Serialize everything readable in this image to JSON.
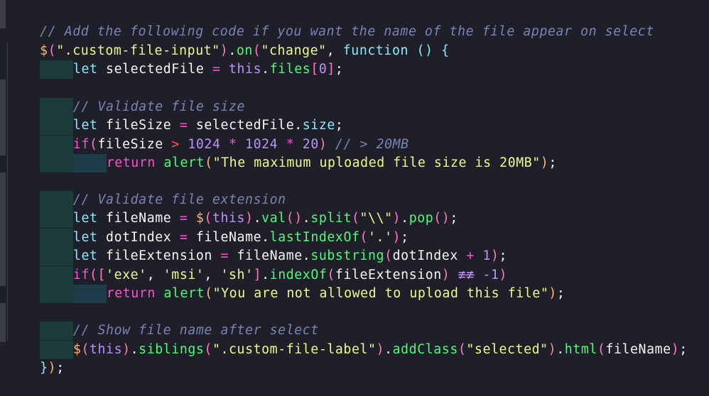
{
  "editor": {
    "theme_colors": {
      "background": "#1e1f29",
      "comment": "#7a84b5",
      "keyword": "#ff4fd4",
      "function": "#50fa7b",
      "string": "#f1fa8c",
      "number": "#bd93f9",
      "operator": "#ff5555",
      "indent_guide_1": "#1b3a3a",
      "indent_guide_2": "#1e3b4a"
    },
    "lines": [
      {
        "tokens": [
          "// Add the following code if you want the name of the file appear on select"
        ]
      },
      {
        "tokens": [
          "$",
          "(",
          "\".custom-file-input\"",
          ")",
          ".",
          "on",
          "(",
          "\"change\"",
          ", ",
          "function",
          " ",
          "()",
          " ",
          "{"
        ]
      },
      {
        "tokens": [
          "let",
          " selectedFile ",
          "=",
          " ",
          "this",
          ".",
          "files",
          "[",
          "0",
          "]",
          ";"
        ]
      },
      {
        "tokens": []
      },
      {
        "tokens": [
          "// Validate file size"
        ]
      },
      {
        "tokens": [
          "let",
          " fileSize ",
          "=",
          " selectedFile.",
          "size",
          ";"
        ]
      },
      {
        "tokens": [
          "if",
          "(",
          "fileSize ",
          ">",
          " ",
          "1024",
          " ",
          "*",
          " ",
          "1024",
          " ",
          "*",
          " ",
          "20",
          ")",
          " ",
          "// > 20MB"
        ]
      },
      {
        "tokens": [
          "return",
          " ",
          "alert",
          "(",
          "\"The maximum uploaded file size is 20MB\"",
          ")",
          ";"
        ]
      },
      {
        "tokens": []
      },
      {
        "tokens": [
          "// Validate file extension"
        ]
      },
      {
        "tokens": [
          "let",
          " fileName ",
          "=",
          " ",
          "$",
          "(",
          "this",
          ")",
          ".",
          "val",
          "()",
          ".",
          "split",
          "(",
          "\"\\\\\"",
          ")",
          ".",
          "pop",
          "()",
          ";"
        ]
      },
      {
        "tokens": [
          "let",
          " dotIndex ",
          "=",
          " fileName.",
          "lastIndexOf",
          "(",
          "'.'",
          ")",
          ";"
        ]
      },
      {
        "tokens": [
          "let",
          " fileExtension ",
          "=",
          " fileName.",
          "substring",
          "(",
          "dotIndex ",
          "+",
          " ",
          "1",
          ")",
          ";"
        ]
      },
      {
        "tokens": [
          "if",
          "([",
          "'exe'",
          ", ",
          "'msi'",
          ", ",
          "'sh'",
          "]",
          ".",
          "indexOf",
          "(",
          "fileExtension",
          ")",
          " ",
          "≢≢",
          " ",
          "-1",
          ")"
        ]
      },
      {
        "tokens": [
          "return",
          " ",
          "alert",
          "(",
          "\"You are not allowed to upload this file\"",
          ")",
          ";"
        ]
      },
      {
        "tokens": []
      },
      {
        "tokens": [
          "// Show file name after select"
        ]
      },
      {
        "tokens": [
          "$",
          "(",
          "this",
          ")",
          ".",
          "siblings",
          "(",
          "\".custom-file-label\"",
          ")",
          ".",
          "addClass",
          "(",
          "\"selected\"",
          ")",
          ".",
          "html",
          "(",
          "fileName",
          ")",
          ";"
        ]
      },
      {
        "tokens": [
          "}",
          ")",
          ";"
        ]
      }
    ]
  }
}
